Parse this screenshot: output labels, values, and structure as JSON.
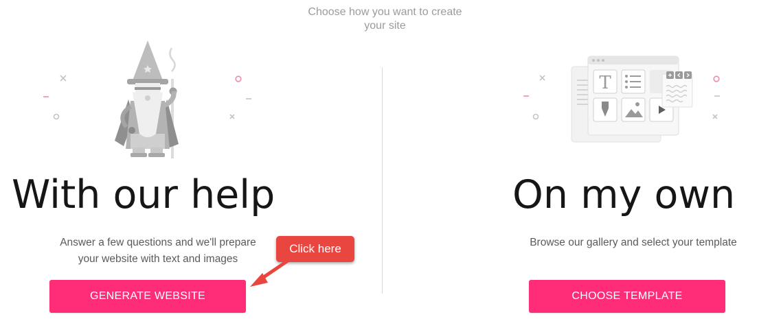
{
  "header": {
    "subtitle_line1": "Choose how you want to create",
    "subtitle_line2": "your site"
  },
  "left_option": {
    "icon": "wizard-illustration",
    "title": "With our help",
    "description_line1": "Answer a few questions and we'll prepare",
    "description_line2": "your website with text and images",
    "button_label": "GENERATE WEBSITE"
  },
  "right_option": {
    "icon": "editor-illustration",
    "title": "On my own",
    "description": "Browse our gallery and select your template",
    "button_label": "CHOOSE TEMPLATE"
  },
  "annotation": {
    "callout_text": "Click here"
  },
  "colors": {
    "accent": "#ff2d78",
    "callout": "#e8463f",
    "subtitle": "#9b9b9b"
  }
}
